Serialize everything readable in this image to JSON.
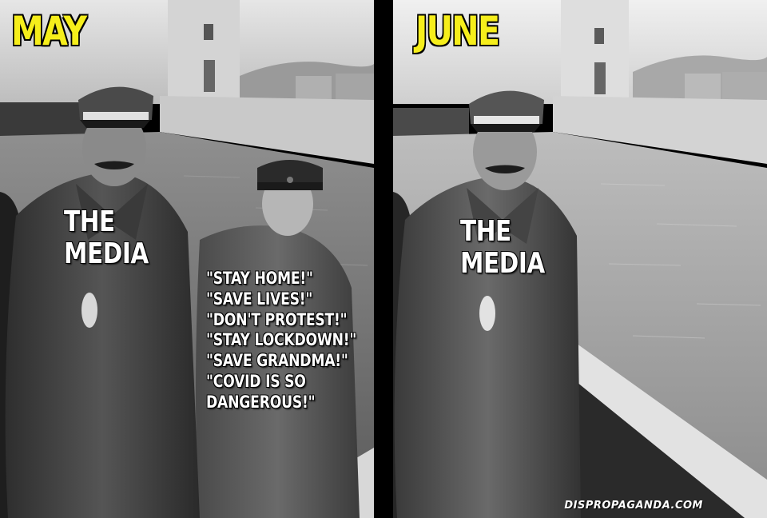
{
  "left_panel": {
    "title": "MAY",
    "media_line1": "THE",
    "media_line2": "MEDIA",
    "quotes": [
      "\"STAY HOME!\"",
      "\"SAVE LIVES!\"",
      "\"DON'T PROTEST!\"",
      "\"STAY LOCKDOWN!\"",
      "\"SAVE GRANDMA!\"",
      "\"COVID IS SO",
      "DANGEROUS!\""
    ]
  },
  "right_panel": {
    "title": "JUNE",
    "media_line1": "THE",
    "media_line2": "MEDIA",
    "watermark": "DISPROPAGANDA.COM"
  },
  "colors": {
    "title": "#f6ee1b",
    "label": "#ffffff",
    "background": "#000000"
  }
}
